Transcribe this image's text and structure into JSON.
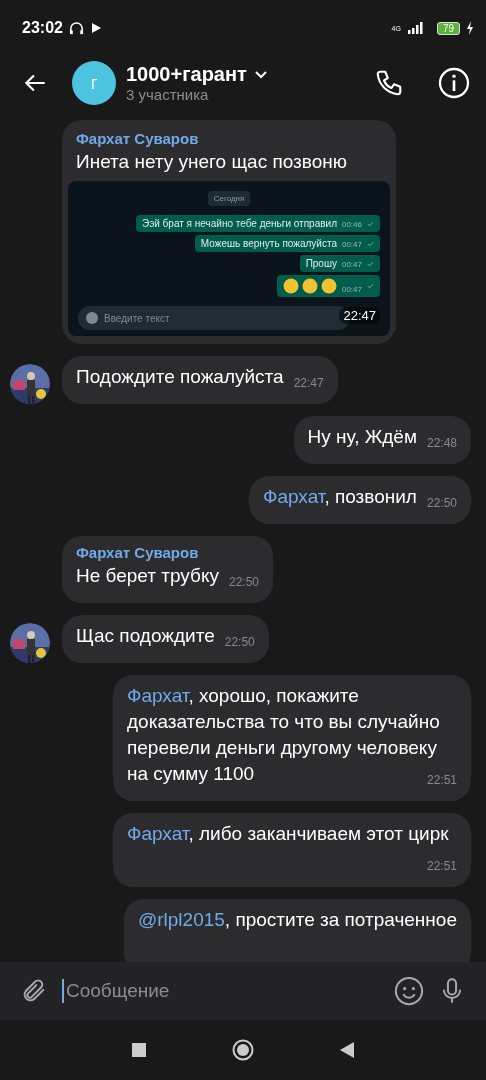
{
  "status_bar": {
    "time": "23:02",
    "network": "4G",
    "battery": "79"
  },
  "header": {
    "avatar_letter": "г",
    "title": "1000+гарант",
    "subtitle": "3 участника"
  },
  "messages": [
    {
      "kind": "incoming",
      "avatar": false,
      "sender": "Фархат Суваров",
      "text": "Инета нету унего щас позвоню",
      "time": "22:47",
      "screenshot": {
        "day": "Сегодня",
        "placeholder": "Введите текст",
        "messages": [
          {
            "kind": "text",
            "text": "Ээй  брат я нечайно тебе деньги отправил",
            "time": "00:46"
          },
          {
            "kind": "text",
            "text": "Можешь вернуть пожалуйста",
            "time": "00:47"
          },
          {
            "kind": "text",
            "text": "Прошу",
            "time": "00:47"
          },
          {
            "kind": "emoji",
            "time": "00:47"
          }
        ]
      }
    },
    {
      "kind": "incoming",
      "avatar": true,
      "text": "Подождите пожалуйста",
      "time": "22:47"
    },
    {
      "kind": "outgoing",
      "text": "Ну ну, Ждём",
      "time": "22:48"
    },
    {
      "kind": "outgoing",
      "mention": "Фархат",
      "text": ", позвонил",
      "time": "22:50"
    },
    {
      "kind": "incoming",
      "avatar": false,
      "sender": "Фархат Суваров",
      "text": "Не берет трубку",
      "time": "22:50"
    },
    {
      "kind": "incoming",
      "avatar": true,
      "text": "Щас подождите",
      "time": "22:50"
    },
    {
      "kind": "outgoing",
      "mention": "Фархат",
      "text": ", хорошо, покажите доказательства то что вы случайно перевели деньги другому человеку на сумму 1100",
      "time": "22:51"
    },
    {
      "kind": "outgoing",
      "mention": "Фархат",
      "text": ", либо заканчиваем этот цирк",
      "time": "22:51"
    },
    {
      "kind": "outgoing",
      "mention": "@rlpl2015",
      "text": ", простите за потраченное"
    }
  ],
  "composer": {
    "placeholder": "Сообщение"
  }
}
